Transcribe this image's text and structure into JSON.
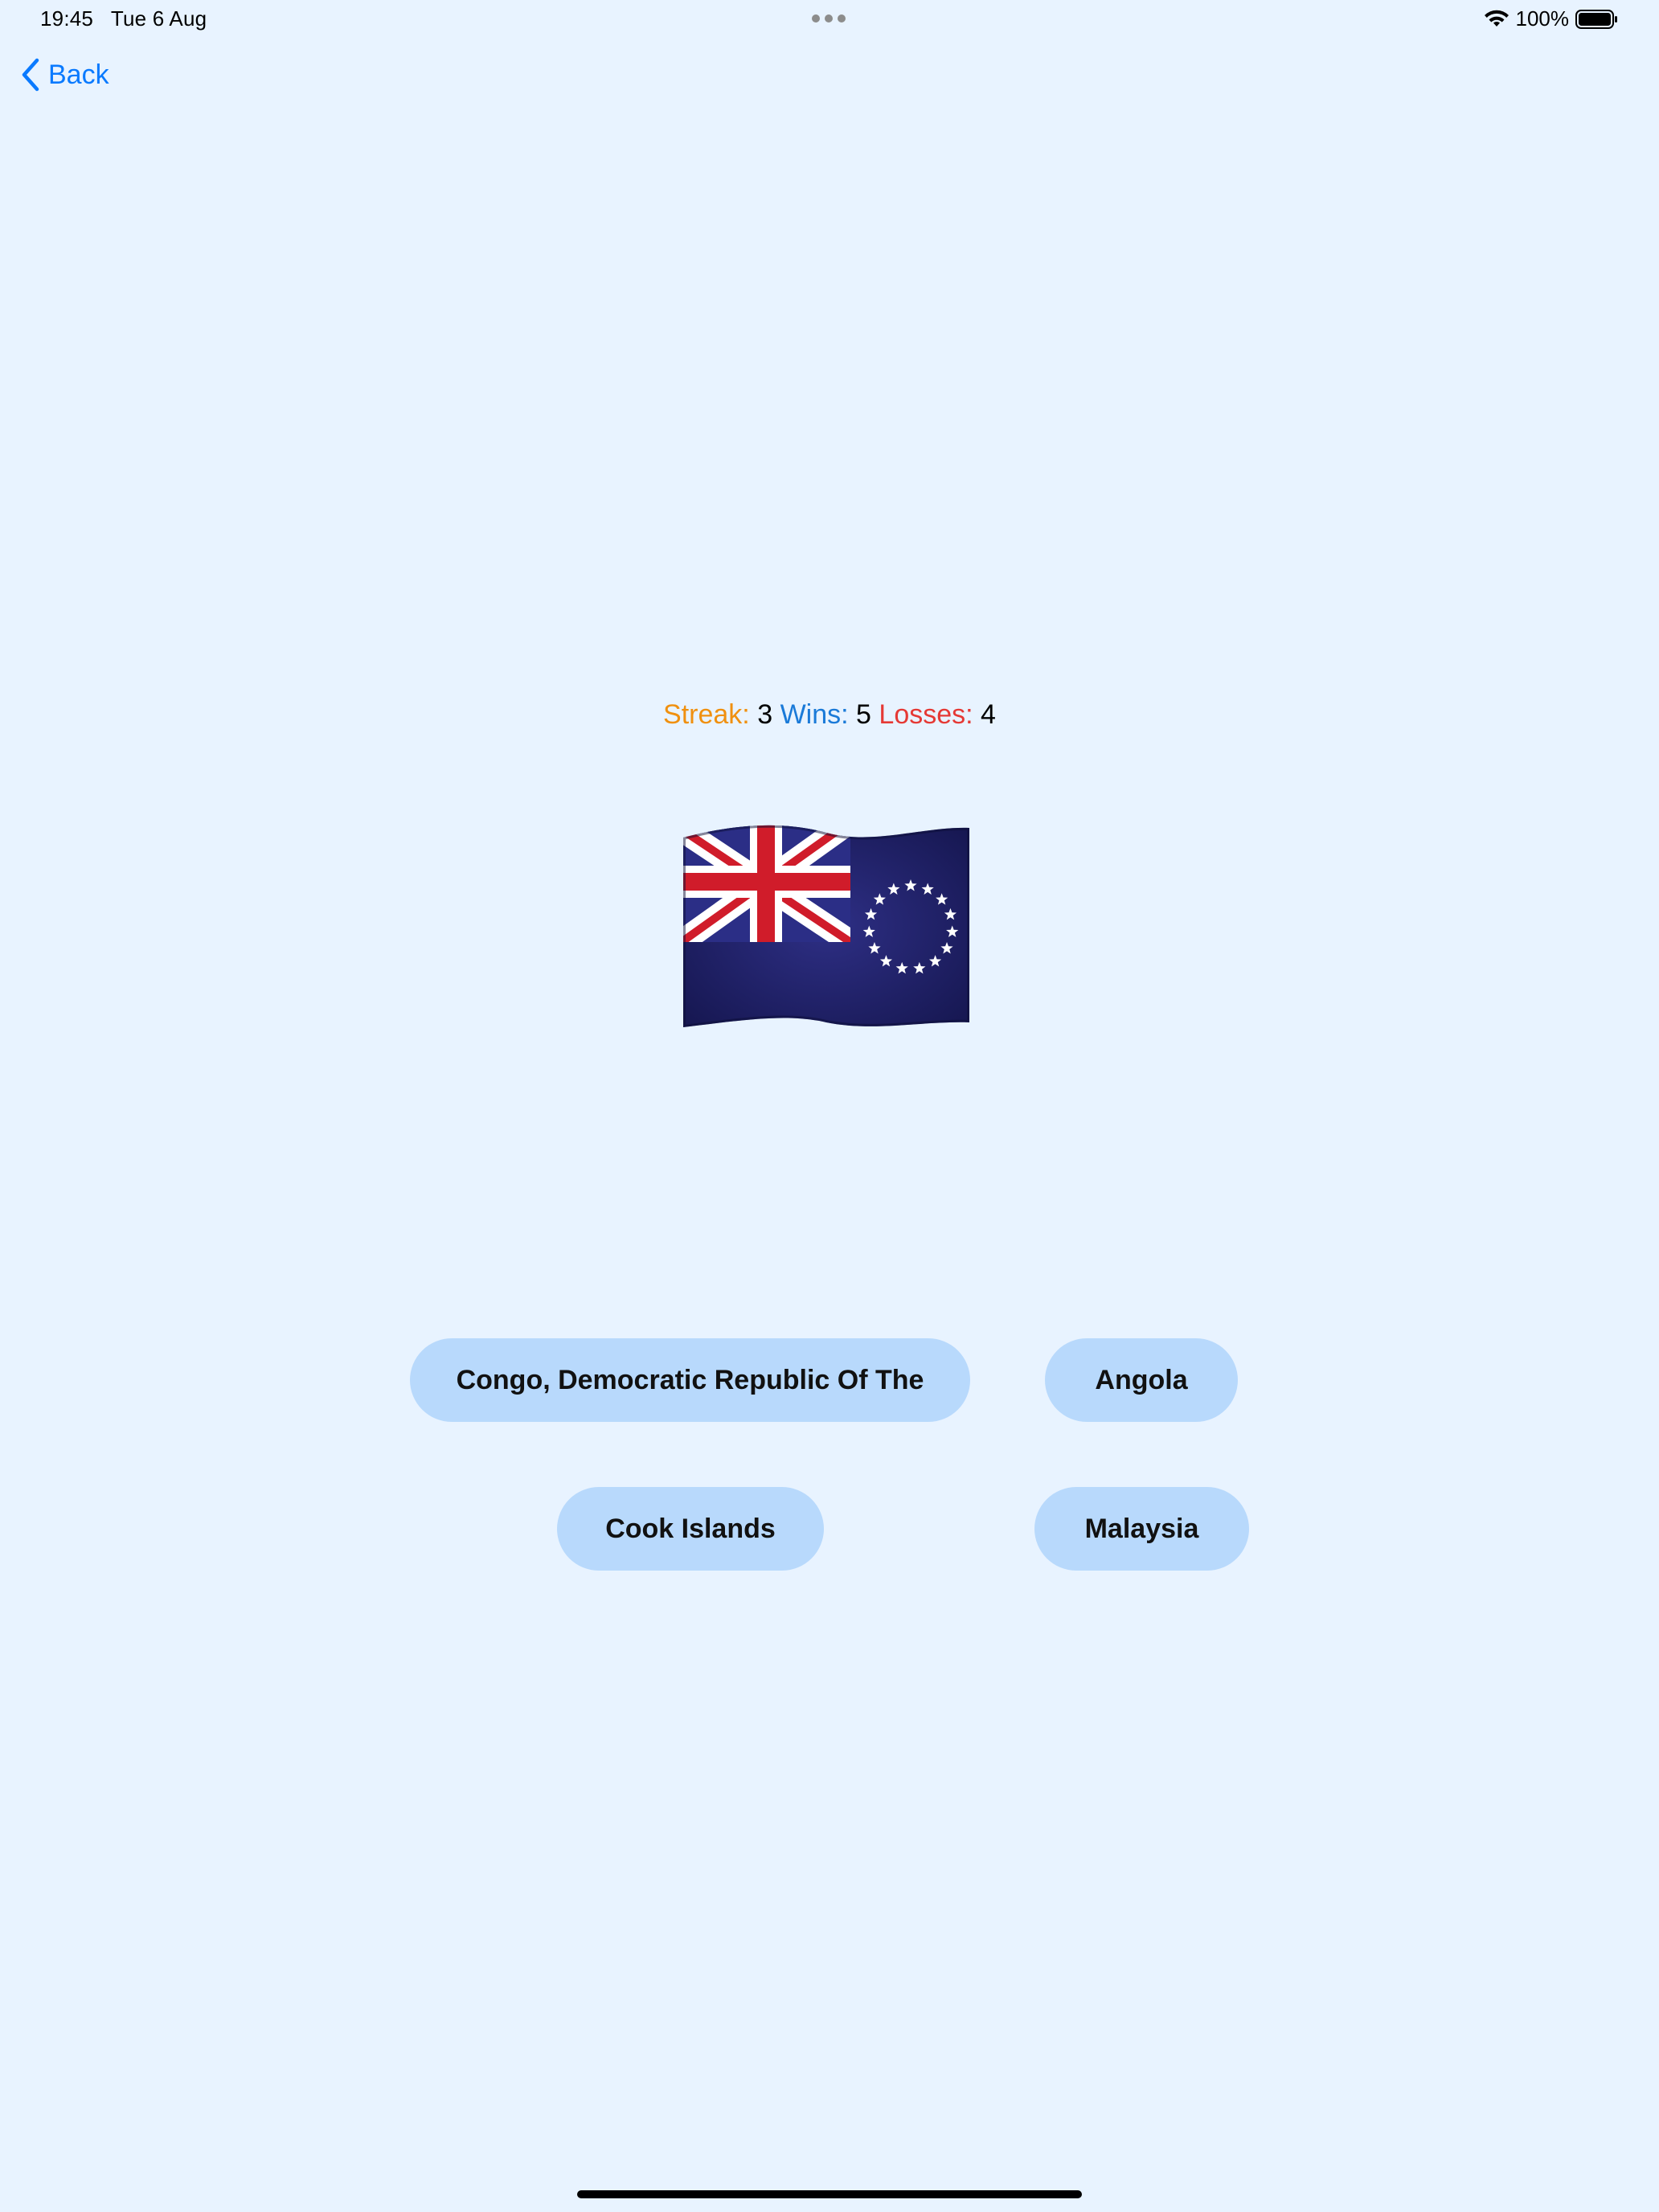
{
  "status_bar": {
    "time": "19:45",
    "date": "Tue 6 Aug",
    "battery_percent": "100%",
    "battery_level": 1.0
  },
  "nav": {
    "back_label": "Back"
  },
  "score": {
    "streak_label": "Streak:",
    "streak_value": "3",
    "wins_label": "Wins:",
    "wins_value": "5",
    "losses_label": "Losses:",
    "losses_value": "4"
  },
  "flag": {
    "icon": "cook-islands-flag"
  },
  "answers": [
    {
      "label": "Congo, Democratic Republic Of The"
    },
    {
      "label": "Angola"
    },
    {
      "label": "Cook Islands"
    },
    {
      "label": "Malaysia"
    }
  ],
  "colors": {
    "background": "#e8f3ff",
    "button": "#b8d9fc",
    "accent": "#0a7aff",
    "streak": "#f0900f",
    "wins": "#1a7ad8",
    "losses": "#e53935"
  }
}
